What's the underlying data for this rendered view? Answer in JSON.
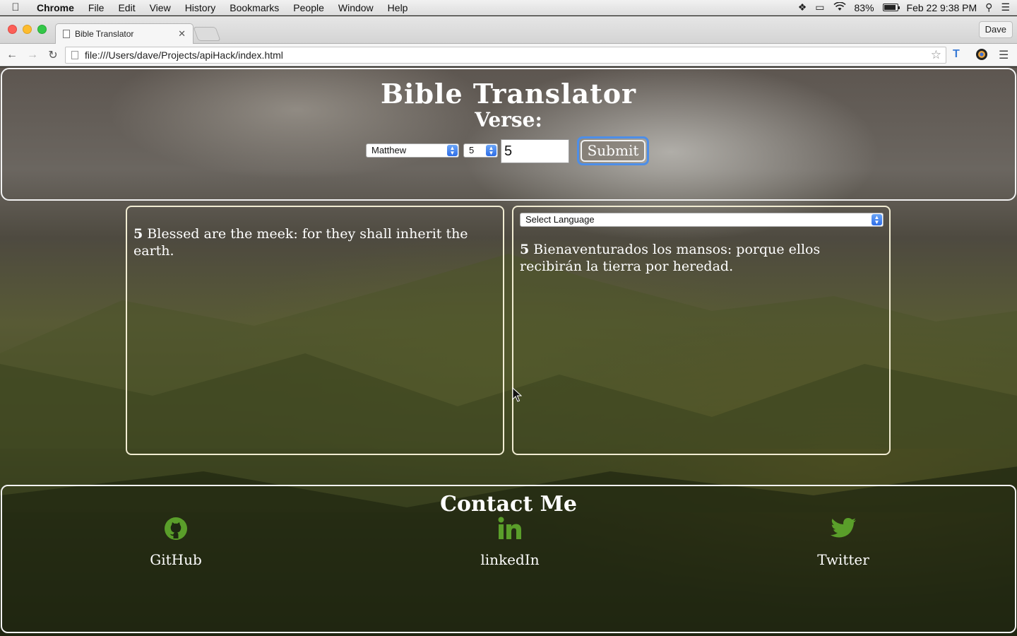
{
  "menubar": {
    "app_name": "Chrome",
    "items": [
      "File",
      "Edit",
      "View",
      "History",
      "Bookmarks",
      "People",
      "Window",
      "Help"
    ],
    "battery": "83%",
    "datetime": "Feb 22  9:38 PM"
  },
  "browser": {
    "tab_title": "Bible Translator",
    "profile": "Dave",
    "url": "file:///Users/dave/Projects/apiHack/index.html"
  },
  "page": {
    "title": "Bible Translator",
    "subtitle": "Verse:",
    "book_select": "Matthew",
    "chapter_select": "5",
    "verse_input": "5",
    "submit_label": "Submit",
    "original": {
      "verse_number": "5",
      "text": "Blessed are the meek: for they shall inherit the earth."
    },
    "translation": {
      "language_select": "Select Language",
      "verse_number": "5",
      "text": "Bienaventurados los mansos: porque ellos recibirán la tierra por heredad."
    },
    "contact": {
      "title": "Contact Me",
      "links": [
        {
          "label": "GitHub",
          "icon": "github-icon"
        },
        {
          "label": "linkedIn",
          "icon": "linkedin-icon"
        },
        {
          "label": "Twitter",
          "icon": "twitter-icon"
        }
      ]
    }
  },
  "colors": {
    "social_icon": "#5a9e2a",
    "panel_border": "#f1ecd2",
    "focus_ring": "#4d8ee8"
  }
}
